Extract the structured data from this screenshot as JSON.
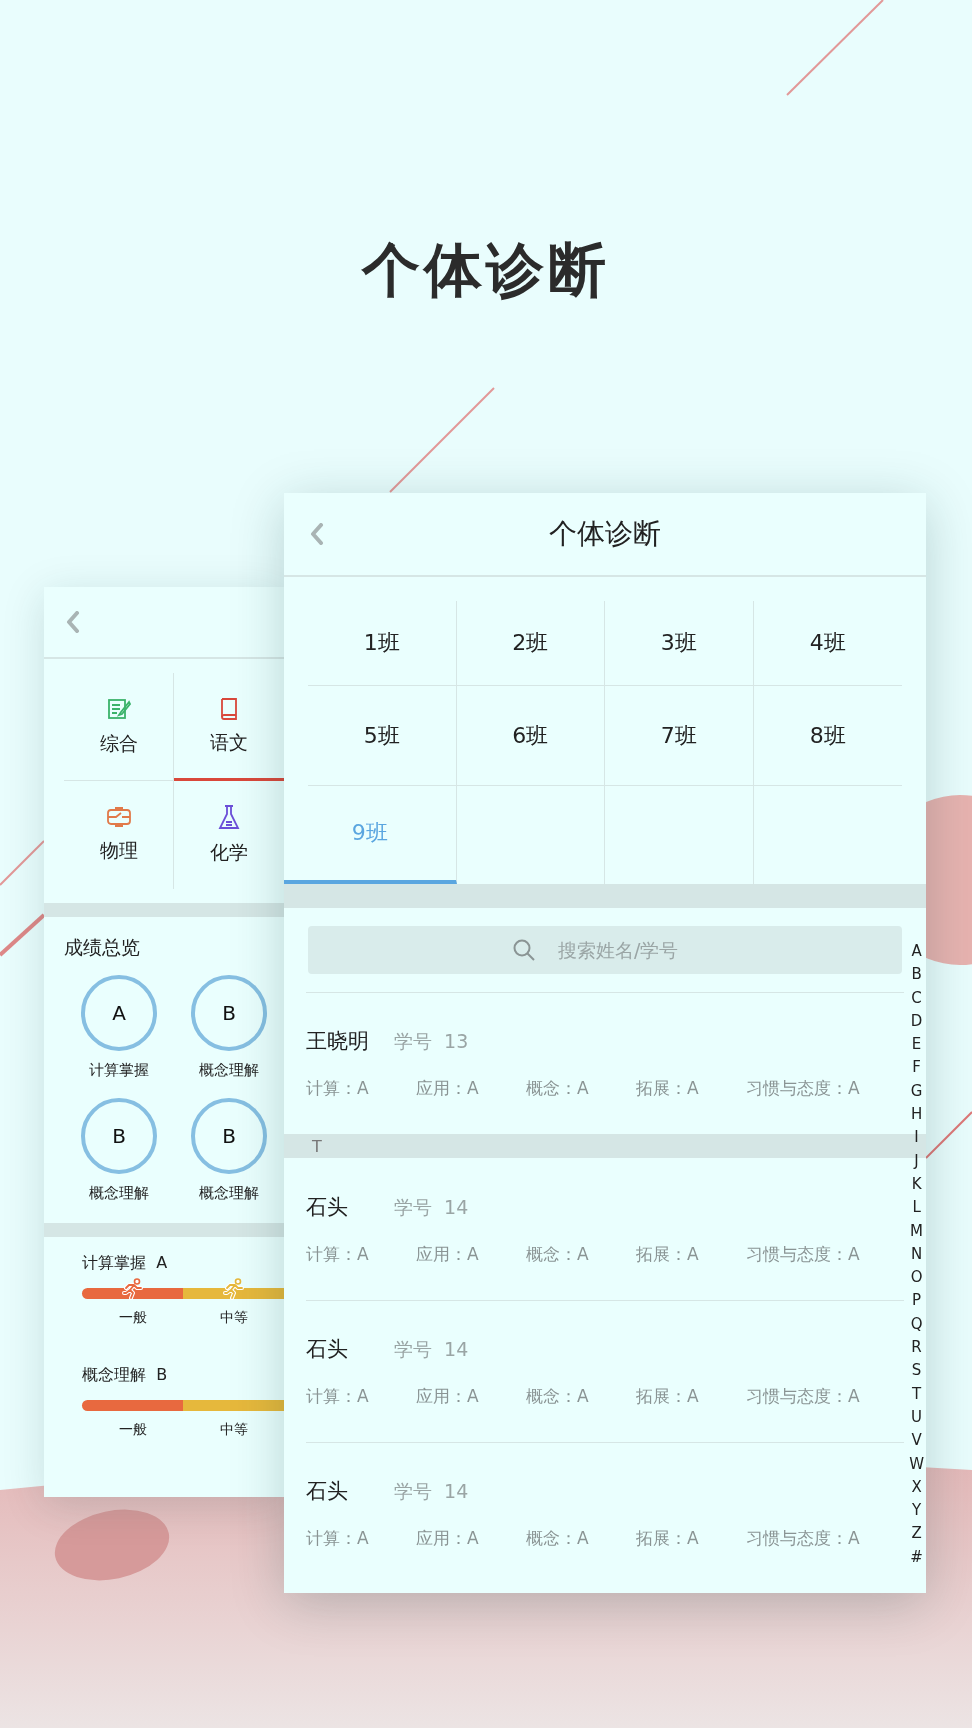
{
  "headline": "个体诊断",
  "back_card": {
    "subjects": [
      {
        "label": "综合",
        "kind": "notepad",
        "selected": false
      },
      {
        "label": "语文",
        "kind": "book",
        "selected": true
      },
      {
        "label": "物理",
        "kind": "circuit",
        "selected": false
      },
      {
        "label": "化学",
        "kind": "flask",
        "selected": false
      }
    ],
    "overview": {
      "title": "成绩总览",
      "grades": [
        {
          "grade": "A",
          "label": "计算掌握"
        },
        {
          "grade": "B",
          "label": "概念理解"
        },
        {
          "grade": "B",
          "label": "概念理解"
        },
        {
          "grade": "B",
          "label": "概念理解"
        }
      ]
    },
    "abilities": [
      {
        "label": "计算掌握",
        "grade": "A",
        "segments": [
          {
            "label": "一般",
            "color": "#e8693f",
            "runner": true
          },
          {
            "label": "中等",
            "color": "#e6b83c",
            "runner": true
          }
        ]
      },
      {
        "label": "概念理解",
        "grade": "B",
        "segments": [
          {
            "label": "一般",
            "color": "#e8693f",
            "runner": false
          },
          {
            "label": "中等",
            "color": "#e6b83c",
            "runner": false
          }
        ]
      }
    ]
  },
  "front_card": {
    "title": "个体诊断",
    "classes": [
      {
        "label": "1班",
        "selected": false
      },
      {
        "label": "2班",
        "selected": false
      },
      {
        "label": "3班",
        "selected": false
      },
      {
        "label": "4班",
        "selected": false
      },
      {
        "label": "5班",
        "selected": false
      },
      {
        "label": "6班",
        "selected": false
      },
      {
        "label": "7班",
        "selected": false
      },
      {
        "label": "8班",
        "selected": false
      },
      {
        "label": "9班",
        "selected": true
      }
    ],
    "search": {
      "placeholder": "搜索姓名/学号"
    },
    "list": [
      {
        "kind": "student",
        "name": "王晓明",
        "number": "学号  13",
        "scores": [
          "计算：A",
          "应用：A",
          "概念：A",
          "拓展：A",
          "习惯与态度：A"
        ]
      },
      {
        "kind": "section",
        "label": "T"
      },
      {
        "kind": "student",
        "name": "石头",
        "number": "学号  14",
        "scores": [
          "计算：A",
          "应用：A",
          "概念：A",
          "拓展：A",
          "习惯与态度：A"
        ]
      },
      {
        "kind": "student",
        "name": "石头",
        "number": "学号  14",
        "scores": [
          "计算：A",
          "应用：A",
          "概念：A",
          "拓展：A",
          "习惯与态度：A"
        ]
      },
      {
        "kind": "student",
        "name": "石头",
        "number": "学号  14",
        "scores": [
          "计算：A",
          "应用：A",
          "概念：A",
          "拓展：A",
          "习惯与态度：A"
        ]
      }
    ],
    "index": [
      "A",
      "B",
      "C",
      "D",
      "E",
      "F",
      "G",
      "H",
      "I",
      "J",
      "K",
      "L",
      "M",
      "N",
      "O",
      "P",
      "Q",
      "R",
      "S",
      "T",
      "U",
      "V",
      "W",
      "X",
      "Y",
      "Z",
      "#"
    ]
  }
}
